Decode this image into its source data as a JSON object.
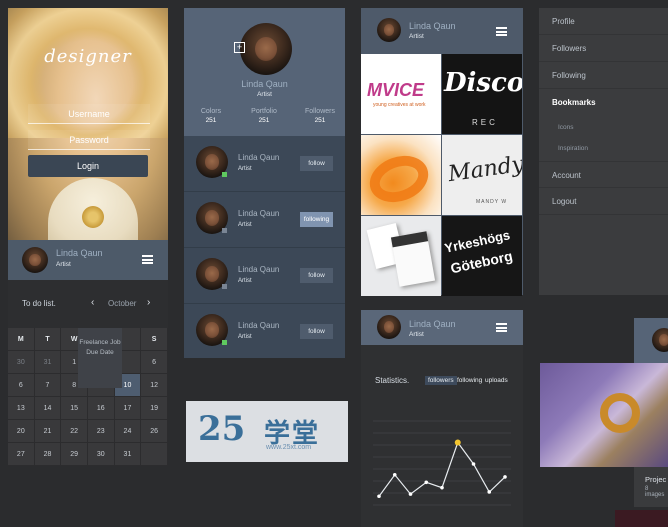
{
  "login": {
    "brand": "designer",
    "username_placeholder": "Username",
    "password_placeholder": "Password",
    "login_label": "Login"
  },
  "profile": {
    "name": "Linda Qaun",
    "role": "Artist"
  },
  "calendar": {
    "title": "To do list.",
    "month": "October",
    "prev_glyph": "‹",
    "next_glyph": "›",
    "weekdays": [
      "M",
      "T",
      "W",
      "",
      "",
      "S"
    ],
    "days": [
      "30",
      "31",
      "1",
      "",
      "",
      "6",
      "6",
      "7",
      "8",
      "9",
      "10",
      "12",
      "13",
      "14",
      "15",
      "16",
      "17",
      "19",
      "20",
      "21",
      "22",
      "23",
      "24",
      "26",
      "27",
      "28",
      "29",
      "30",
      "31",
      ""
    ],
    "selected_day": "10",
    "event": {
      "line1": "Freelance Job",
      "line2": "Due Date"
    }
  },
  "followers_panel": {
    "stats": [
      {
        "label": "Colors",
        "value": "251"
      },
      {
        "label": "Portfolio",
        "value": "251"
      },
      {
        "label": "Followers",
        "value": "251"
      }
    ],
    "rows": [
      {
        "name": "Linda Qaun",
        "role": "Artist",
        "button": "follow",
        "active": false
      },
      {
        "name": "Linda Qaun",
        "role": "Artist",
        "button": "following",
        "active": true
      },
      {
        "name": "Linda Qaun",
        "role": "Artist",
        "button": "follow",
        "active": false
      },
      {
        "name": "Linda Qaun",
        "role": "Artist",
        "button": "follow",
        "active": false
      }
    ]
  },
  "portfolio": {
    "tiles": [
      {
        "text": "MVICE",
        "sub": "young creatives at work"
      },
      {
        "text": "Disco",
        "sub": "REC"
      },
      {
        "text": "",
        "sub": ""
      },
      {
        "text": "Mandy",
        "sub": "MANDY W"
      },
      {
        "text": "",
        "sub": ""
      },
      {
        "text": "Yrkeshögs",
        "sub": "Göteborg"
      }
    ]
  },
  "statistics": {
    "title": "Statistics.",
    "tabs": [
      "followers",
      "following",
      "uploads"
    ],
    "active_tab": "followers",
    "chart_data": {
      "type": "line",
      "values": [
        1,
        3,
        1.2,
        2.3,
        1.8,
        6,
        4,
        1.4,
        2.8
      ],
      "highlight_index": 5,
      "ylim": [
        0,
        8
      ]
    }
  },
  "side_menu": {
    "items": [
      "Profile",
      "Followers",
      "Following",
      "Bookmarks",
      "Account",
      "Logout"
    ],
    "active": "Bookmarks",
    "sub_items": [
      "Icons",
      "Inspiration"
    ]
  },
  "project_card": {
    "title": "Projec",
    "subtitle": "8 images"
  },
  "watermark": {
    "number": "25",
    "text": "学堂",
    "url": "www.25xt.com"
  },
  "colors": {
    "accent": "#566477",
    "highlight": "#f3c52f",
    "online": "#5fc95f",
    "selected": "#4e5d70"
  }
}
